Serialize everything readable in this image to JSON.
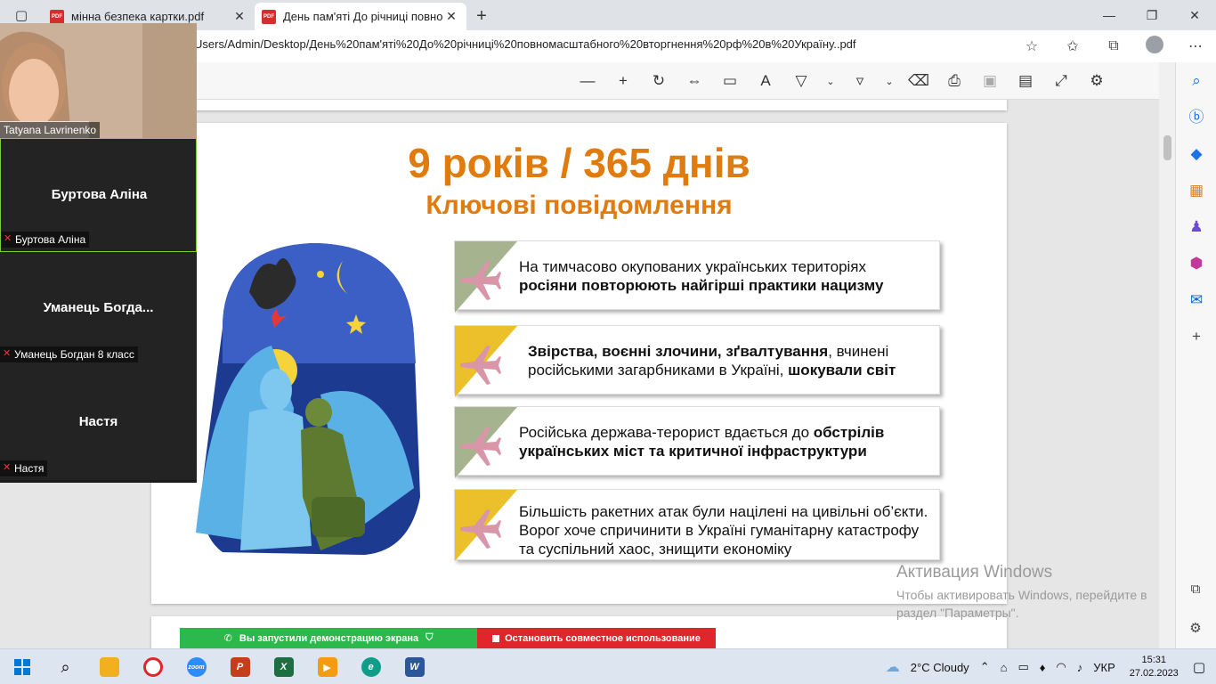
{
  "tabs": [
    {
      "label": "мінна безпека картки.pdf",
      "active": false
    },
    {
      "label": "День пам'яті До річниці повном",
      "active": true
    }
  ],
  "address": {
    "url": "Users/Admin/Desktop/День%20пам'яті%20До%20річниці%20повномасштабного%20вторгнення%20рф%20в%20Україну..pdf"
  },
  "slide": {
    "title": "9 років / 365 днів",
    "subtitle": "Ключові повідомлення",
    "messages": [
      {
        "pre": "На тимчасово окупованих українських територіях",
        "bold": "росіяни повторюють найгірші практики нацизму",
        "post": "",
        "color": "#a6b38f"
      },
      {
        "pre": "",
        "bold": "Звірства, воєнні злочини, зґвалтування",
        "post": ", вчинені російськими загарбниками в Україні, ",
        "bold2": "шокували світ",
        "color": "#ebc02a"
      },
      {
        "pre": "Російська держава-терорист вдається до ",
        "bold": "обстрілів українських міст та критичної інфраструктури",
        "post": "",
        "color": "#a6b38f"
      },
      {
        "pre": "Більшість ракетних атак були націлені на цивільні об’єкти. Ворог хоче спричинити в Україні гуманітарну катастрофу та суспільний хаос, знищити економіку",
        "bold": "",
        "post": "",
        "color": "#ebc02a"
      }
    ]
  },
  "zoom": {
    "video_name": "Tatyana Lavrinenko",
    "participants": [
      {
        "display": "Буртова Аліна",
        "tag": "Буртова Аліна"
      },
      {
        "display": "Уманець  Богда...",
        "tag": "Уманець Богдан 8 класс"
      },
      {
        "display": "Настя",
        "tag": "Настя"
      }
    ],
    "share_status": "Вы запустили демонстрацию экрана",
    "stop_share": "Остановить совместное использование"
  },
  "watermark": {
    "line1": "Активация Windows",
    "line2": "Чтобы активировать Windows, перейдите в",
    "line3": "раздел \"Параметры\"."
  },
  "taskbar": {
    "weather": "2°C  Cloudy",
    "lang": "УКР",
    "time": "15:31",
    "date": "27.02.2023"
  },
  "colors": {
    "accent": "#e07b10",
    "green": "#a6b38f",
    "yellow": "#ebc02a",
    "plane": "#d896a8"
  }
}
